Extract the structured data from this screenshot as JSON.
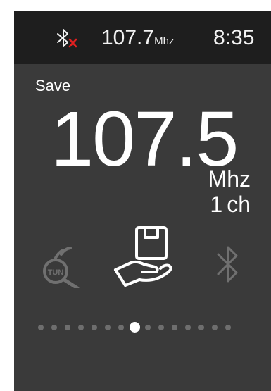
{
  "status_bar": {
    "bluetooth_icon": "bluetooth-disconnected-icon",
    "bluetooth_x_color": "#e02020",
    "frequency_value": "107.7",
    "frequency_unit": "Mhz",
    "time": "8:35"
  },
  "main": {
    "mode_label": "Save",
    "frequency": "107.5",
    "frequency_unit": "Mhz",
    "channel_number": "1",
    "channel_label": "ch"
  },
  "menu": {
    "items": [
      {
        "icon": "tune-search-icon",
        "label": "TUN",
        "active": false
      },
      {
        "icon": "save-hand-box-icon",
        "active": true
      },
      {
        "icon": "bluetooth-icon",
        "active": false
      }
    ]
  },
  "pager": {
    "total": 15,
    "current": 8
  },
  "colors": {
    "background": "#3a3a3a",
    "status_bar": "#1e1e1e",
    "inactive_icon": "#707070",
    "active": "#ffffff"
  }
}
